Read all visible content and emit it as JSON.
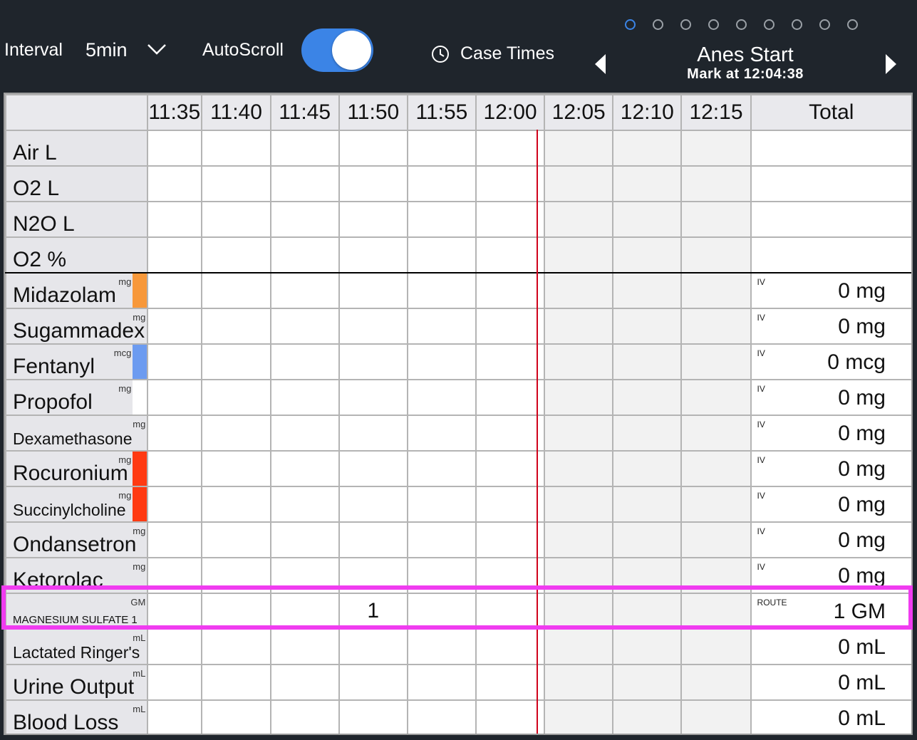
{
  "toolbar": {
    "interval_label": "Interval",
    "interval_value": "5min",
    "autoscroll_label": "AutoScroll",
    "autoscroll_on": true,
    "case_times_label": "Case Times",
    "page_dot_count": 9,
    "active_page_index": 0
  },
  "event": {
    "title": "Anes Start",
    "subtitle": "Mark at 12:04:38"
  },
  "grid": {
    "time_columns": [
      "11:35",
      "11:40",
      "11:45",
      "11:50",
      "11:55",
      "12:00",
      "12:05",
      "12:10",
      "12:15"
    ],
    "total_label": "Total",
    "rows": [
      {
        "name": "Air L",
        "unit": "",
        "route": "",
        "total": "",
        "values": [
          "",
          "",
          "",
          "",
          "",
          "",
          "",
          "",
          ""
        ]
      },
      {
        "name": "O2 L",
        "unit": "",
        "route": "",
        "total": "",
        "values": [
          "",
          "",
          "",
          "",
          "",
          "",
          "",
          "",
          ""
        ]
      },
      {
        "name": "N2O L",
        "unit": "",
        "route": "",
        "total": "",
        "values": [
          "",
          "",
          "",
          "",
          "",
          "",
          "",
          "",
          ""
        ]
      },
      {
        "name": "O2 %",
        "unit": "",
        "route": "",
        "total": "",
        "values": [
          "",
          "",
          "",
          "",
          "",
          "",
          "",
          "",
          ""
        ]
      },
      {
        "name": "Midazolam",
        "unit": "mg",
        "route": "IV",
        "total": "0 mg",
        "color": "#f7983a",
        "values": [
          "",
          "",
          "",
          "",
          "",
          "",
          "",
          "",
          ""
        ]
      },
      {
        "name": "Sugammadex",
        "unit": "mg",
        "route": "IV",
        "total": "0 mg",
        "values": [
          "",
          "",
          "",
          "",
          "",
          "",
          "",
          "",
          ""
        ]
      },
      {
        "name": "Fentanyl",
        "unit": "mcg",
        "route": "IV",
        "total": "0 mcg",
        "color": "#6c9bf0",
        "values": [
          "",
          "",
          "",
          "",
          "",
          "",
          "",
          "",
          ""
        ]
      },
      {
        "name": "Propofol",
        "unit": "mg",
        "route": "IV",
        "total": "0 mg",
        "color": "#ffffff",
        "values": [
          "",
          "",
          "",
          "",
          "",
          "",
          "",
          "",
          ""
        ]
      },
      {
        "name": "Dexamethasone",
        "unit": "mg",
        "route": "IV",
        "total": "0 mg",
        "values": [
          "",
          "",
          "",
          "",
          "",
          "",
          "",
          "",
          ""
        ]
      },
      {
        "name": "Rocuronium",
        "unit": "mg",
        "route": "IV",
        "total": "0 mg",
        "color": "#ff3a12",
        "values": [
          "",
          "",
          "",
          "",
          "",
          "",
          "",
          "",
          ""
        ]
      },
      {
        "name": "Succinylcholine",
        "unit": "mg",
        "route": "IV",
        "total": "0 mg",
        "color": "#ff3a12",
        "values": [
          "",
          "",
          "",
          "",
          "",
          "",
          "",
          "",
          ""
        ]
      },
      {
        "name": "Ondansetron",
        "unit": "mg",
        "route": "IV",
        "total": "0 mg",
        "values": [
          "",
          "",
          "",
          "",
          "",
          "",
          "",
          "",
          ""
        ]
      },
      {
        "name": "Ketorolac",
        "unit": "mg",
        "route": "IV",
        "total": "0 mg",
        "values": [
          "",
          "",
          "",
          "",
          "",
          "",
          "",
          "",
          ""
        ]
      },
      {
        "name": "MAGNESIUM SULFATE 1",
        "unit": "GM",
        "route": "ROUTE",
        "total": "1 GM",
        "values": [
          "",
          "",
          "",
          "1",
          "",
          "",
          "",
          "",
          ""
        ]
      },
      {
        "name": "Lactated Ringer's",
        "unit": "mL",
        "route": "",
        "total": "0 mL",
        "values": [
          "",
          "",
          "",
          "",
          "",
          "",
          "",
          "",
          ""
        ]
      },
      {
        "name": "Urine Output",
        "unit": "mL",
        "route": "",
        "total": "0 mL",
        "values": [
          "",
          "",
          "",
          "",
          "",
          "",
          "",
          "",
          ""
        ]
      },
      {
        "name": "Blood Loss",
        "unit": "mL",
        "route": "",
        "total": "0 mL",
        "values": [
          "",
          "",
          "",
          "",
          "",
          "",
          "",
          "",
          ""
        ]
      }
    ]
  }
}
